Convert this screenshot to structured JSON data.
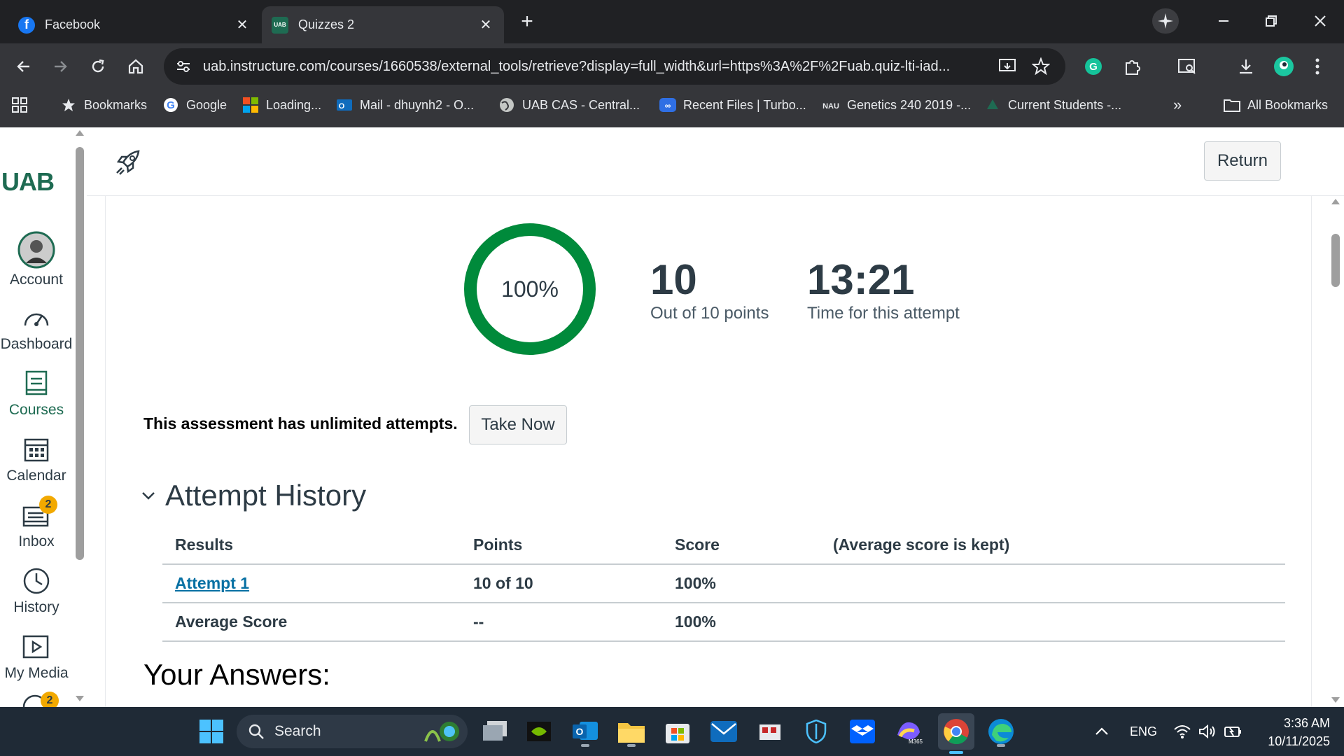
{
  "browser": {
    "tabs": [
      {
        "title": "Facebook",
        "favicon": "facebook-icon",
        "active": false
      },
      {
        "title": "Quizzes 2",
        "favicon": "uab-icon",
        "active": true
      }
    ],
    "url": "uab.instructure.com/courses/1660538/external_tools/retrieve?display=full_width&url=https%3A%2F%2Fuab.quiz-lti-iad..."
  },
  "bookmarks": [
    {
      "label": "Bookmarks",
      "icon": "star-icon"
    },
    {
      "label": "Google",
      "icon": "google-icon"
    },
    {
      "label": "Loading...",
      "icon": "microsoft-icon"
    },
    {
      "label": "Mail - dhuynh2 - O...",
      "icon": "outlook-icon"
    },
    {
      "label": "UAB CAS - Central...",
      "icon": "globe-icon"
    },
    {
      "label": "Recent Files | Turbo...",
      "icon": "turbo-icon"
    },
    {
      "label": "Genetics 240 2019 -...",
      "icon": "nau-icon"
    },
    {
      "label": "Current Students -...",
      "icon": "tree-icon"
    },
    {
      "label": "All Bookmarks",
      "icon": "folder-icon"
    }
  ],
  "leftnav": {
    "logo": "UAB",
    "items": [
      {
        "label": "Account",
        "icon": "avatar"
      },
      {
        "label": "Dashboard",
        "icon": "dashboard-icon"
      },
      {
        "label": "Courses",
        "icon": "courses-icon",
        "active": true
      },
      {
        "label": "Calendar",
        "icon": "calendar-icon"
      },
      {
        "label": "Inbox",
        "icon": "inbox-icon",
        "badge": "2"
      },
      {
        "label": "History",
        "icon": "history-icon"
      },
      {
        "label": "My Media",
        "icon": "media-icon"
      }
    ],
    "partial_badge": "2"
  },
  "quiz": {
    "return_label": "Return",
    "score_percent": "100%",
    "score_fraction": 1.0,
    "points": "10",
    "points_caption": "Out of 10 points",
    "time": "13:21",
    "time_caption": "Time for this attempt",
    "unlimited_text": "This assessment has unlimited attempts.",
    "take_now": "Take Now",
    "history_title": "Attempt History",
    "columns": [
      "Results",
      "Points",
      "Score",
      "(Average score is kept)"
    ],
    "rows": [
      {
        "result": "Attempt 1",
        "points": "10 of 10",
        "score": "100%"
      },
      {
        "result": "Average Score",
        "points": "--",
        "score": "100%"
      }
    ],
    "answers_title": "Your Answers:"
  },
  "taskbar": {
    "search_label": "Search",
    "lang": "ENG",
    "time": "3:36 AM",
    "date": "10/11/2025"
  },
  "colors": {
    "ring_green": "#008a3b",
    "canvas_green": "#1e6b52",
    "link_blue": "#0770a3",
    "badge_yellow": "#f2a900"
  }
}
